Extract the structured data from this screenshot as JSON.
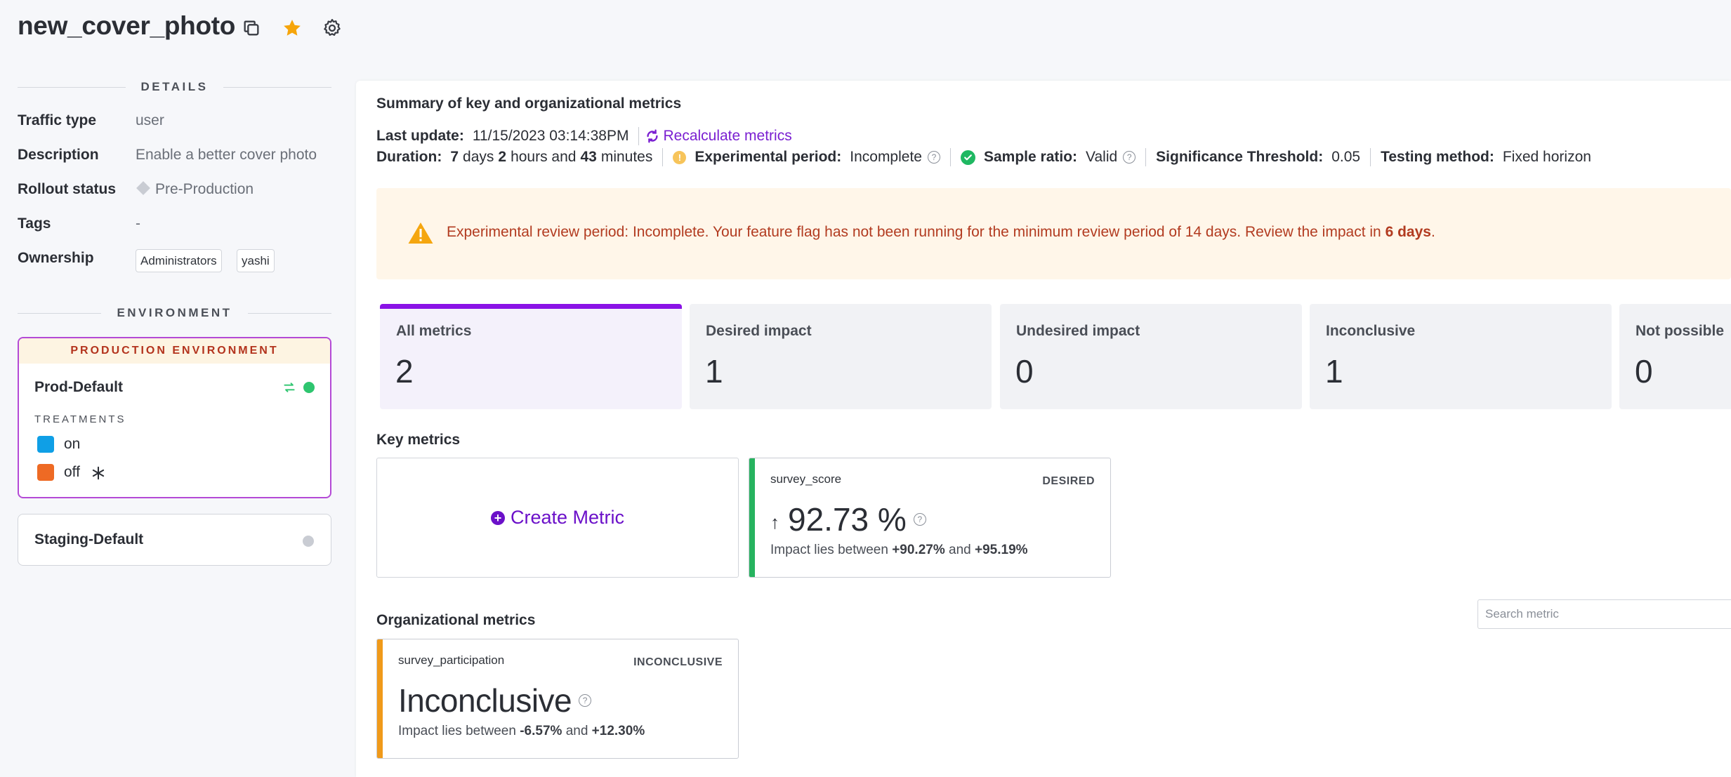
{
  "header": {
    "title": "new_cover_photo"
  },
  "details": {
    "heading": "DETAILS",
    "rows": [
      {
        "label": "Traffic type",
        "value": "user"
      },
      {
        "label": "Description",
        "value": "Enable a better cover photo"
      },
      {
        "label": "Rollout status",
        "value": "Pre-Production"
      },
      {
        "label": "Tags",
        "value": "-"
      },
      {
        "label": "Ownership",
        "value": ""
      }
    ],
    "owners": [
      "Administrators",
      "yashi"
    ]
  },
  "environment": {
    "heading": "ENVIRONMENT",
    "production_banner": "PRODUCTION ENVIRONMENT",
    "prod_name": "Prod-Default",
    "treatments_heading": "TREATMENTS",
    "treatments": [
      {
        "label": "on",
        "color": "#0f9fe6"
      },
      {
        "label": "off",
        "color": "#ee6a24"
      }
    ],
    "staging_name": "Staging-Default",
    "status_active_color": "#2ec56f",
    "status_inactive_color": "#c9ccd3"
  },
  "summary": {
    "title": "Summary of key and organizational metrics",
    "last_update_label": "Last update:",
    "last_update_value": "11/15/2023 03:14:38PM",
    "recalculate_label": "Recalculate metrics",
    "duration_label": "Duration:",
    "duration_days": "7",
    "duration_days_unit": "days",
    "duration_hours": "2",
    "duration_hours_unit": "hours and",
    "duration_minutes": "43",
    "duration_minutes_unit": "minutes",
    "experimental_period_label": "Experimental period:",
    "experimental_period_value": "Incomplete",
    "sample_ratio_label": "Sample ratio:",
    "sample_ratio_value": "Valid",
    "significance_label": "Significance Threshold:",
    "significance_value": "0.05",
    "testing_method_label": "Testing method:",
    "testing_method_value": "Fixed horizon"
  },
  "warning": {
    "text": "Experimental review period: Incomplete. Your feature flag has not been running for the minimum review period of 14 days. Review the impact in",
    "days": "6 days",
    "period": "."
  },
  "tiles": [
    {
      "label": "All metrics",
      "value": "2"
    },
    {
      "label": "Desired impact",
      "value": "1"
    },
    {
      "label": "Undesired impact",
      "value": "0"
    },
    {
      "label": "Inconclusive",
      "value": "1"
    },
    {
      "label": "Not possible",
      "value": "0"
    }
  ],
  "key_metrics": {
    "title": "Key metrics",
    "create_label": "Create Metric",
    "card": {
      "name": "survey_score",
      "tag": "DESIRED",
      "arrow": "↑",
      "value": "92.73 %",
      "sub_prefix": "Impact lies between",
      "low": "+90.27%",
      "and": "and",
      "high": "+95.19%",
      "accent": "#27b35f"
    }
  },
  "org_metrics": {
    "title": "Organizational metrics",
    "search_placeholder": "Search metric",
    "card": {
      "name": "survey_participation",
      "tag": "INCONCLUSIVE",
      "value": "Inconclusive",
      "sub_prefix": "Impact lies between",
      "low": "-6.57%",
      "and": "and",
      "high": "+12.30%",
      "accent": "#f09a1a"
    }
  }
}
